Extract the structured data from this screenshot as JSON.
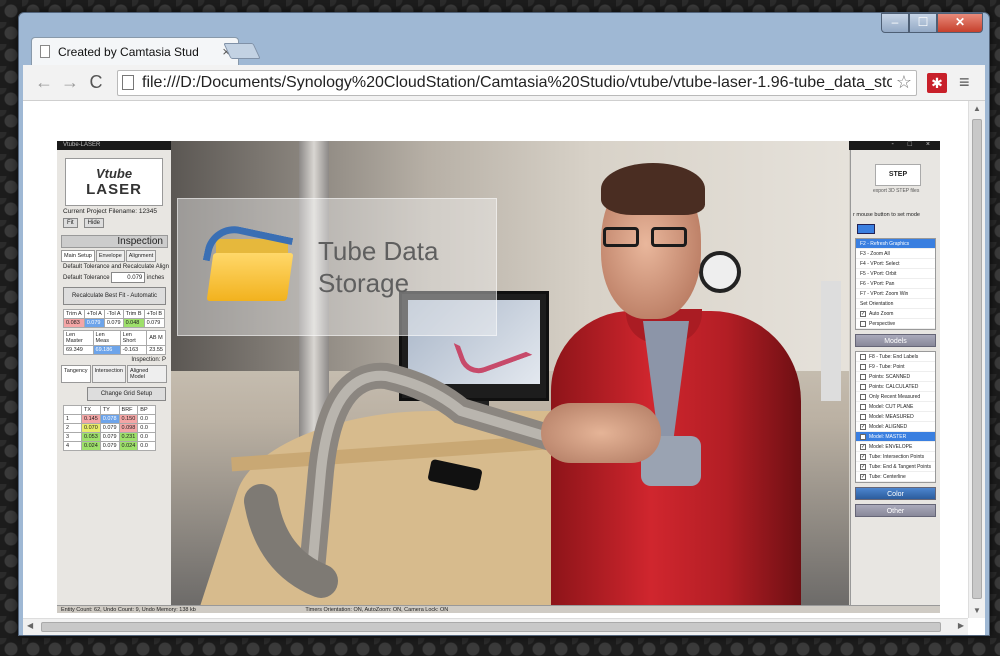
{
  "browser": {
    "tab_title": "Created by Camtasia Stud",
    "tab_close": "×",
    "url": "file:///D:/Documents/Synology%20CloudStation/Camtasia%20Studio/vtube/vtube-laser-1.96-tube_data_sto",
    "back": "←",
    "forward": "→",
    "reload": "C",
    "star": "☆",
    "extension": "✱",
    "menu": "≡",
    "window_min": "–",
    "window_max": "☐",
    "window_close": "✕"
  },
  "app": {
    "window_title": "Vtube-LASER",
    "window_controls": "- □ ×",
    "logo_line1": "Vtube",
    "logo_line2": "LASER",
    "current_project": "Current Project Filename: 12345",
    "btn_a": "Fit",
    "btn_b": "Hide",
    "inspection_header": "Inspection",
    "tabs": [
      "Main Setup",
      "Envelope",
      "Alignment"
    ],
    "default_tolerance_caption": "Default Tolerance and Recalculate Align",
    "default_tolerance_label": "Default Tolerance",
    "default_tolerance_value": "0.079",
    "default_tolerance_unit": "inches",
    "recalc_button": "Recalculate Best Fit - Automatic",
    "tol_headers": [
      "Trim A",
      "+Tol A",
      "-Tol A",
      "Trim B",
      "+Tol B"
    ],
    "tol_values": [
      "0.083",
      "0.079",
      "0.079",
      "0.048",
      "0.079"
    ],
    "len_headers": [
      "Len Master",
      "Len Meas",
      "Len Short",
      "AB M"
    ],
    "len_values": [
      "69.349",
      "69.186",
      "-0.163",
      "23.55"
    ],
    "inspection_sub": "Inspection: P",
    "lower_tabs": [
      "Tangency",
      "Intersection",
      "Aligned Model"
    ],
    "change_grid_button": "Change Grid Setup",
    "grid_headers": [
      "",
      "TX",
      "TY",
      "BRF",
      "BP"
    ],
    "grid_rows": [
      [
        "1",
        "0.145",
        "0.078",
        "0.150",
        "0.0"
      ],
      [
        "2",
        "0.070",
        "0.079",
        "0.098",
        "0.0"
      ],
      [
        "3",
        "0.053",
        "0.079",
        "0.231",
        "0.0"
      ],
      [
        "4",
        "0.024",
        "0.079",
        "0.024",
        "0.0"
      ]
    ],
    "step_logo": "STEP",
    "step_caption": "export 3D STEP files",
    "right_hint": "r mouse button to set mode",
    "view_items": [
      "F2 - Refresh Graphics",
      "F3 - Zoom All",
      "F4 - VPort: Select",
      "F5 - VPort: Orbit",
      "F6 - VPort: Pan",
      "F7 - VPort: Zoom Win",
      "Set Orientation",
      "Auto Zoom",
      "Perspective"
    ],
    "models_bar": "Models",
    "model_items": [
      "F8 - Tube: End Labels",
      "F9 - Tube: Point",
      "Points: SCANNED",
      "Points: CALCULATED",
      "Only Recent Measured",
      "Model: CUT PLANE",
      "Model: MEASURED",
      "Model: ALIGNED",
      "Model: MASTER",
      "Model: ENVELOPE",
      "Tube: Intersection Points",
      "Tube: End & Tangent Points",
      "Tube: Centerline"
    ],
    "color_bar": "Color",
    "other_bar": "Other",
    "status_left": "Entity Count: 62, Undo Count: 9, Undo Memory: 138 kb",
    "status_right": "Timers   Orientation: ON, AutoZoom: ON, Camera Lock: ON"
  },
  "video_overlay": {
    "title": "Tube Data\nStorage"
  }
}
